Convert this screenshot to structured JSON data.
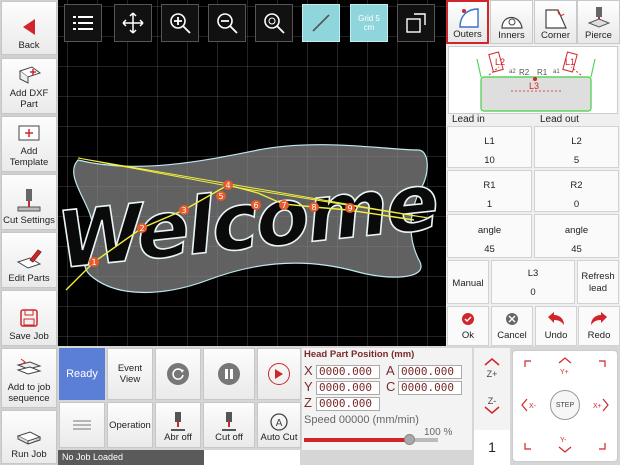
{
  "sidebar": {
    "items": [
      {
        "label": "Back",
        "icon": "back-arrow-icon"
      },
      {
        "label": "Add DXF Part",
        "icon": "add-dxf-icon"
      },
      {
        "label": "Add Template",
        "icon": "add-template-icon"
      },
      {
        "label": "Cut Settings",
        "icon": "cut-settings-icon"
      },
      {
        "label": "Edit Parts",
        "icon": "edit-parts-icon"
      },
      {
        "label": "Save Job",
        "icon": "save-icon"
      },
      {
        "label": "Add to job sequence",
        "icon": "job-sequence-icon"
      },
      {
        "label": "Run Job",
        "icon": "run-job-icon"
      }
    ]
  },
  "toolbar": {
    "grid_label": "Grid 5 cm",
    "tools": [
      "list-icon",
      "move-icon",
      "zoom-in-icon",
      "zoom-out-icon",
      "zoom-fit-icon",
      "line-tool-icon",
      "grid-toggle-icon",
      "fullscreen-icon"
    ]
  },
  "canvas": {
    "part_text": "Welcome",
    "path_numbers": [
      "1",
      "2",
      "3",
      "4",
      "5",
      "6",
      "7",
      "8",
      "9"
    ]
  },
  "leads": {
    "tabs": [
      "Outers",
      "Inners",
      "Corner",
      "Pierce"
    ],
    "active_tab": "Outers",
    "diagram_labels": {
      "l2": "L2",
      "a2": "a2",
      "r2": "R2",
      "r1": "R1",
      "a1": "a1",
      "l1": "L1",
      "l3": "L3"
    },
    "lead_in_header": "Lead in",
    "lead_out_header": "Lead out",
    "fields": [
      {
        "label": "L1",
        "value": "10"
      },
      {
        "label": "L2",
        "value": "5"
      },
      {
        "label": "R1",
        "value": "1"
      },
      {
        "label": "R2",
        "value": "0"
      },
      {
        "label": "angle",
        "value": "45"
      },
      {
        "label": "angle",
        "value": "45"
      }
    ],
    "manual": "Manual",
    "l3_label": "L3",
    "l3_value": "0",
    "refresh": "Refresh lead",
    "actions": [
      "Ok",
      "Cancel",
      "Undo",
      "Redo"
    ]
  },
  "controls": {
    "ready": "Ready",
    "event_view": "Event View",
    "operation": "Operation",
    "abr_off": "Abr off",
    "cut_off": "Cut off",
    "auto_cut": "Auto Cut",
    "status": "No Job Loaded"
  },
  "dro": {
    "title": "Head Part Position (mm)",
    "x_label": "X",
    "x_value": "0000.000",
    "y_label": "Y",
    "y_value": "0000.000",
    "z_label": "Z",
    "z_value": "0000.000",
    "a_label": "A",
    "a_value": "0000.000",
    "c_label": "C",
    "c_value": "0000.000",
    "speed_label": "Speed 00000",
    "speed_unit": "(mm/min)",
    "speed_percent": "100 %",
    "speed_fraction": 0.78
  },
  "jog": {
    "z_plus": "Z+",
    "z_minus": "Z-",
    "step_count": "1",
    "y_plus": "Y+",
    "y_minus": "Y-",
    "x_minus": "X-",
    "x_plus": "X+",
    "step": "STEP"
  },
  "colors": {
    "accent": "#d0262b",
    "canvas_bg": "#000000",
    "path": "#f2ee3c",
    "highlight": "#8fd6dc",
    "ready": "#5b7fd6"
  }
}
